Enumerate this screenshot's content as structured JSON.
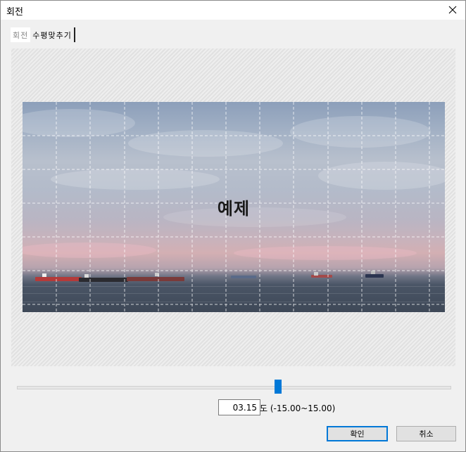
{
  "window": {
    "title": "회전"
  },
  "tabs": [
    {
      "label": "회전"
    },
    {
      "label": "수평맞추기"
    }
  ],
  "preview": {
    "watermark": "예제"
  },
  "rotation": {
    "value": "03.15",
    "unit_range_label": "도 (-15.00~15.00)",
    "min": -15.0,
    "max": 15.0,
    "current": 3.15
  },
  "buttons": {
    "ok": "확인",
    "cancel": "취소"
  },
  "colors": {
    "accent": "#0078d7"
  },
  "icons": {
    "close": "close-icon"
  }
}
